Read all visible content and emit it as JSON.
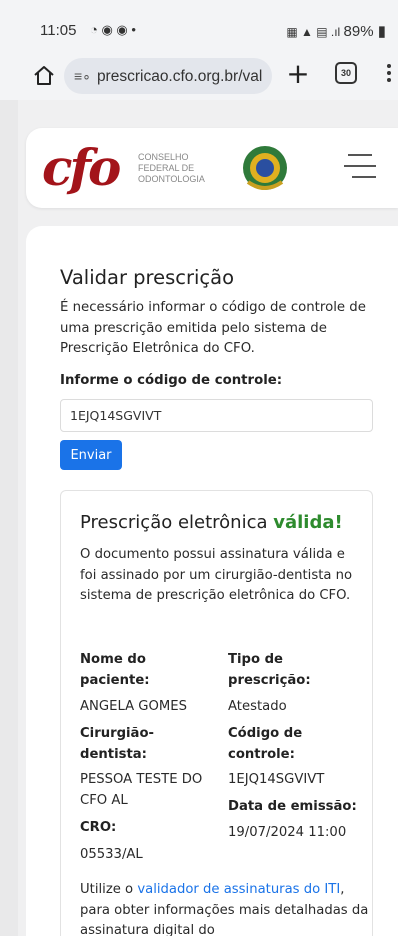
{
  "status_bar": {
    "time": "11:05",
    "battery": "89%"
  },
  "browser": {
    "url": "prescricao.cfo.org.br/val",
    "tab_count": "30"
  },
  "header": {
    "logo": "cfo",
    "logo_lines": [
      "CONSELHO",
      "FEDERAL DE",
      "ODONTOLOGIA"
    ]
  },
  "form": {
    "title": "Validar prescrição",
    "description": "É necessário informar o código de controle de uma prescrição emitida pelo sistema de Prescrição Eletrônica do CFO.",
    "field_label": "Informe o código de controle:",
    "code_value": "1EJQ14SGVIVT",
    "submit_label": "Enviar"
  },
  "result": {
    "title_prefix": "Prescrição eletrônica",
    "title_status": "válida!",
    "status_color": "#2e8b2e",
    "description": "O documento possui assinatura válida e foi assinado por um cirurgião-dentista no sistema de prescrição eletrônica do CFO.",
    "patient_label": "Nome do paciente:",
    "patient_value": "ANGELA GOMES",
    "type_label": "Tipo de prescrição:",
    "type_value": "Atestado",
    "dentist_label": "Cirurgião-dentista:",
    "dentist_value": "PESSOA TESTE DO CFO AL",
    "code_label": "Código de controle:",
    "code_value": "1EJQ14SGVIVT",
    "cro_label": "CRO:",
    "cro_value": "05533/AL",
    "date_label": "Data de emissão:",
    "date_value": "19/07/2024 11:00",
    "footer_prefix": "Utilize o",
    "footer_link": "validador de assinaturas do ITI",
    "footer_suffix": ", para obter informações mais detalhadas da assinatura digital do"
  }
}
